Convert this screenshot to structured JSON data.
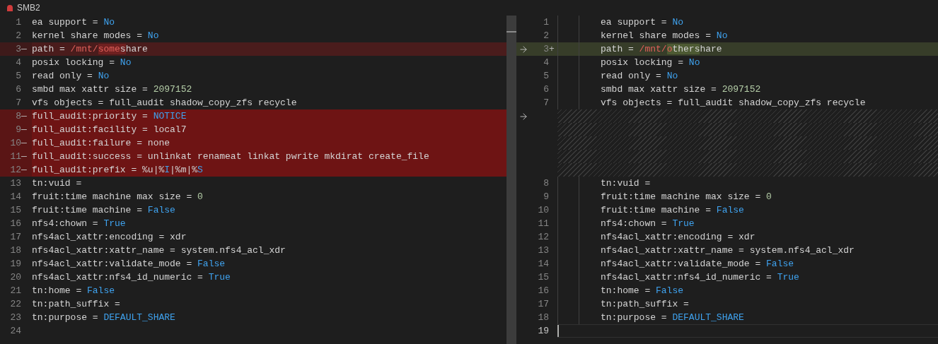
{
  "title": "SMB2",
  "left": {
    "lines": [
      {
        "number": "1",
        "kind": "normal",
        "segments": [
          {
            "text": "ea support = ",
            "kind": "plain"
          },
          {
            "text": "No",
            "kind": "keyword"
          }
        ]
      },
      {
        "number": "2",
        "kind": "normal",
        "segments": [
          {
            "text": "kernel share modes = ",
            "kind": "plain"
          },
          {
            "text": "No",
            "kind": "keyword"
          }
        ]
      },
      {
        "number": "3",
        "marker": "—",
        "kind": "modified",
        "segments": [
          {
            "text": "path = ",
            "kind": "plain",
            "changed": false
          },
          {
            "text": "/mnt/",
            "kind": "string",
            "changed": false
          },
          {
            "text": "some",
            "kind": "string",
            "changed": true
          },
          {
            "text": "s",
            "kind": "plain",
            "changed": true
          },
          {
            "text": "hare",
            "kind": "plain",
            "changed": false
          }
        ]
      },
      {
        "number": "4",
        "kind": "normal",
        "segments": [
          {
            "text": "posix locking = ",
            "kind": "plain"
          },
          {
            "text": "No",
            "kind": "keyword"
          }
        ]
      },
      {
        "number": "5",
        "kind": "normal",
        "segments": [
          {
            "text": "read only = ",
            "kind": "plain"
          },
          {
            "text": "No",
            "kind": "keyword"
          }
        ]
      },
      {
        "number": "6",
        "kind": "normal",
        "segments": [
          {
            "text": "smbd max xattr size = ",
            "kind": "plain"
          },
          {
            "text": "2097152",
            "kind": "number"
          }
        ]
      },
      {
        "number": "7",
        "kind": "normal",
        "segments": [
          {
            "text": "vfs objects = full_audit shadow_copy_zfs recycle",
            "kind": "plain"
          }
        ]
      },
      {
        "number": "8",
        "marker": "—",
        "kind": "removed",
        "segments": [
          {
            "text": "full_audit:priority = ",
            "kind": "plain"
          },
          {
            "text": "NOTICE",
            "kind": "keyword"
          }
        ]
      },
      {
        "number": "9",
        "marker": "—",
        "kind": "removed",
        "segments": [
          {
            "text": "full_audit:facility = local7",
            "kind": "plain"
          }
        ]
      },
      {
        "number": "10",
        "marker": "—",
        "kind": "removed",
        "segments": [
          {
            "text": "full_audit:failure = none",
            "kind": "plain"
          }
        ]
      },
      {
        "number": "11",
        "marker": "—",
        "kind": "removed",
        "segments": [
          {
            "text": "full_audit:success = unlinkat renameat linkat pwrite mkdirat create_file",
            "kind": "plain"
          }
        ]
      },
      {
        "number": "12",
        "marker": "—",
        "kind": "removed",
        "segments": [
          {
            "text": "full_audit:prefix = %u|%",
            "kind": "plain"
          },
          {
            "text": "I",
            "kind": "keyword"
          },
          {
            "text": "|%m|%",
            "kind": "plain"
          },
          {
            "text": "S",
            "kind": "keyword"
          }
        ]
      },
      {
        "number": "13",
        "kind": "normal",
        "segments": [
          {
            "text": "tn:vuid =",
            "kind": "plain"
          }
        ]
      },
      {
        "number": "14",
        "kind": "normal",
        "segments": [
          {
            "text": "fruit:time machine max size = ",
            "kind": "plain"
          },
          {
            "text": "0",
            "kind": "number"
          }
        ]
      },
      {
        "number": "15",
        "kind": "normal",
        "segments": [
          {
            "text": "fruit:time machine = ",
            "kind": "plain"
          },
          {
            "text": "False",
            "kind": "keyword"
          }
        ]
      },
      {
        "number": "16",
        "kind": "normal",
        "segments": [
          {
            "text": "nfs4:chown = ",
            "kind": "plain"
          },
          {
            "text": "True",
            "kind": "keyword"
          }
        ]
      },
      {
        "number": "17",
        "kind": "normal",
        "segments": [
          {
            "text": "nfs4acl_xattr:encoding = xdr",
            "kind": "plain"
          }
        ]
      },
      {
        "number": "18",
        "kind": "normal",
        "segments": [
          {
            "text": "nfs4acl_xattr:xattr_name = system.nfs4_acl_xdr",
            "kind": "plain"
          }
        ]
      },
      {
        "number": "19",
        "kind": "normal",
        "segments": [
          {
            "text": "nfs4acl_xattr:validate_mode = ",
            "kind": "plain"
          },
          {
            "text": "False",
            "kind": "keyword"
          }
        ]
      },
      {
        "number": "20",
        "kind": "normal",
        "segments": [
          {
            "text": "nfs4acl_xattr:nfs4_id_numeric = ",
            "kind": "plain"
          },
          {
            "text": "True",
            "kind": "keyword"
          }
        ]
      },
      {
        "number": "21",
        "kind": "normal",
        "segments": [
          {
            "text": "tn:home = ",
            "kind": "plain"
          },
          {
            "text": "False",
            "kind": "keyword"
          }
        ]
      },
      {
        "number": "22",
        "kind": "normal",
        "segments": [
          {
            "text": "tn:path_suffix =",
            "kind": "plain"
          }
        ]
      },
      {
        "number": "23",
        "kind": "normal",
        "segments": [
          {
            "text": "tn:purpose = ",
            "kind": "plain"
          },
          {
            "text": "DEFAULT_SHARE",
            "kind": "keyword"
          }
        ]
      },
      {
        "number": "24",
        "kind": "normal"
      }
    ]
  },
  "right": {
    "lines": [
      {
        "number": "1",
        "kind": "normal",
        "arrow": false,
        "segments": [
          {
            "text": "ea support = ",
            "kind": "plain"
          },
          {
            "text": "No",
            "kind": "keyword"
          }
        ]
      },
      {
        "number": "2",
        "kind": "normal",
        "arrow": false,
        "segments": [
          {
            "text": "kernel share modes = ",
            "kind": "plain"
          },
          {
            "text": "No",
            "kind": "keyword"
          }
        ]
      },
      {
        "number": "3",
        "marker": "+",
        "kind": "added",
        "arrow": true,
        "segments": [
          {
            "text": "path = ",
            "kind": "plain",
            "changed": false
          },
          {
            "text": "/mnt/",
            "kind": "string",
            "changed": false
          },
          {
            "text": "o",
            "kind": "string",
            "changed": true
          },
          {
            "text": "thers",
            "kind": "plain",
            "changed": true
          },
          {
            "text": "hare",
            "kind": "plain",
            "changed": false
          }
        ]
      },
      {
        "number": "4",
        "kind": "normal",
        "arrow": false,
        "segments": [
          {
            "text": "posix locking = ",
            "kind": "plain"
          },
          {
            "text": "No",
            "kind": "keyword"
          }
        ]
      },
      {
        "number": "5",
        "kind": "normal",
        "arrow": false,
        "segments": [
          {
            "text": "read only = ",
            "kind": "plain"
          },
          {
            "text": "No",
            "kind": "keyword"
          }
        ]
      },
      {
        "number": "6",
        "kind": "normal",
        "arrow": false,
        "segments": [
          {
            "text": "smbd max xattr size = ",
            "kind": "plain"
          },
          {
            "text": "2097152",
            "kind": "number"
          }
        ]
      },
      {
        "number": "7",
        "kind": "normal",
        "arrow": false,
        "segments": [
          {
            "text": "vfs objects = full_audit shadow_copy_zfs recycle",
            "kind": "plain"
          }
        ]
      },
      {
        "kind": "filler",
        "arrow": true
      },
      {
        "kind": "filler",
        "arrow": false
      },
      {
        "kind": "filler",
        "arrow": false
      },
      {
        "kind": "filler",
        "arrow": false
      },
      {
        "kind": "filler",
        "arrow": false
      },
      {
        "number": "8",
        "kind": "normal",
        "arrow": false,
        "segments": [
          {
            "text": "tn:vuid =",
            "kind": "plain"
          }
        ]
      },
      {
        "number": "9",
        "kind": "normal",
        "arrow": false,
        "segments": [
          {
            "text": "fruit:time machine max size = ",
            "kind": "plain"
          },
          {
            "text": "0",
            "kind": "number"
          }
        ]
      },
      {
        "number": "10",
        "kind": "normal",
        "arrow": false,
        "segments": [
          {
            "text": "fruit:time machine = ",
            "kind": "plain"
          },
          {
            "text": "False",
            "kind": "keyword"
          }
        ]
      },
      {
        "number": "11",
        "kind": "normal",
        "arrow": false,
        "segments": [
          {
            "text": "nfs4:chown = ",
            "kind": "plain"
          },
          {
            "text": "True",
            "kind": "keyword"
          }
        ]
      },
      {
        "number": "12",
        "kind": "normal",
        "arrow": false,
        "segments": [
          {
            "text": "nfs4acl_xattr:encoding = xdr",
            "kind": "plain"
          }
        ]
      },
      {
        "number": "13",
        "kind": "normal",
        "arrow": false,
        "segments": [
          {
            "text": "nfs4acl_xattr:xattr_name = system.nfs4_acl_xdr",
            "kind": "plain"
          }
        ]
      },
      {
        "number": "14",
        "kind": "normal",
        "arrow": false,
        "segments": [
          {
            "text": "nfs4acl_xattr:validate_mode = ",
            "kind": "plain"
          },
          {
            "text": "False",
            "kind": "keyword"
          }
        ]
      },
      {
        "number": "15",
        "kind": "normal",
        "arrow": false,
        "segments": [
          {
            "text": "nfs4acl_xattr:nfs4_id_numeric = ",
            "kind": "plain"
          },
          {
            "text": "True",
            "kind": "keyword"
          }
        ]
      },
      {
        "number": "16",
        "kind": "normal",
        "arrow": false,
        "segments": [
          {
            "text": "tn:home = ",
            "kind": "plain"
          },
          {
            "text": "False",
            "kind": "keyword"
          }
        ]
      },
      {
        "number": "17",
        "kind": "normal",
        "arrow": false,
        "segments": [
          {
            "text": "tn:path_suffix =",
            "kind": "plain"
          }
        ]
      },
      {
        "number": "18",
        "kind": "normal",
        "arrow": false,
        "segments": [
          {
            "text": "tn:purpose = ",
            "kind": "plain"
          },
          {
            "text": "DEFAULT_SHARE",
            "kind": "keyword"
          }
        ]
      },
      {
        "number": "19",
        "kind": "current",
        "arrow": false
      }
    ]
  }
}
